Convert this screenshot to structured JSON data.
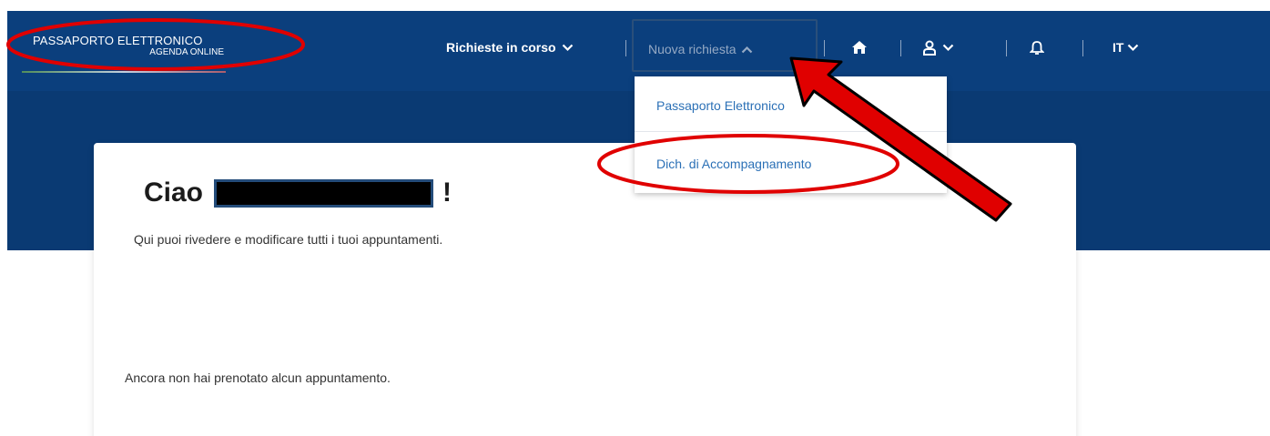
{
  "header": {
    "logo_title": "PASSAPORTO ELETTRONICO",
    "logo_subtitle": "AGENDA ONLINE"
  },
  "nav": {
    "richieste_label": "Richieste in corso",
    "nuova_label": "Nuova richiesta",
    "language_label": "IT",
    "separator": "|"
  },
  "dropdown": {
    "items": [
      {
        "label": "Passaporto Elettronico"
      },
      {
        "label": "Dich. di Accompagnamento"
      }
    ]
  },
  "main": {
    "greeting": "Ciao",
    "greeting_suffix": "!",
    "subtitle": "Qui puoi rivedere e modificare tutti i tuoi appuntamenti.",
    "empty_message": "Ancora non hai prenotato alcun appuntamento."
  },
  "icons": {
    "home": "home-icon",
    "user": "user-icon",
    "bell": "bell-icon",
    "chevron": "chevron-down-icon"
  },
  "colors": {
    "header_bg": "#0b3f7d",
    "hero_bg": "#0a3a73",
    "link_blue": "#2b70b6",
    "annotation_red": "#e00000"
  }
}
